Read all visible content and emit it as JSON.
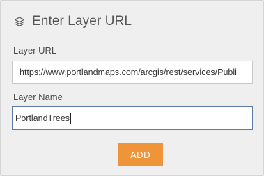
{
  "header": {
    "icon": "layers-icon",
    "title": "Enter Layer URL"
  },
  "form": {
    "url_label": "Layer URL",
    "url_value": "https://www.portlandmaps.com/arcgis/rest/services/Publi",
    "name_label": "Layer Name",
    "name_value": "PortlandTrees"
  },
  "actions": {
    "add_label": "ADD"
  },
  "colors": {
    "accent": "#f0943a",
    "panel_background": "#efefef",
    "focus_border": "#5a7ba3"
  }
}
